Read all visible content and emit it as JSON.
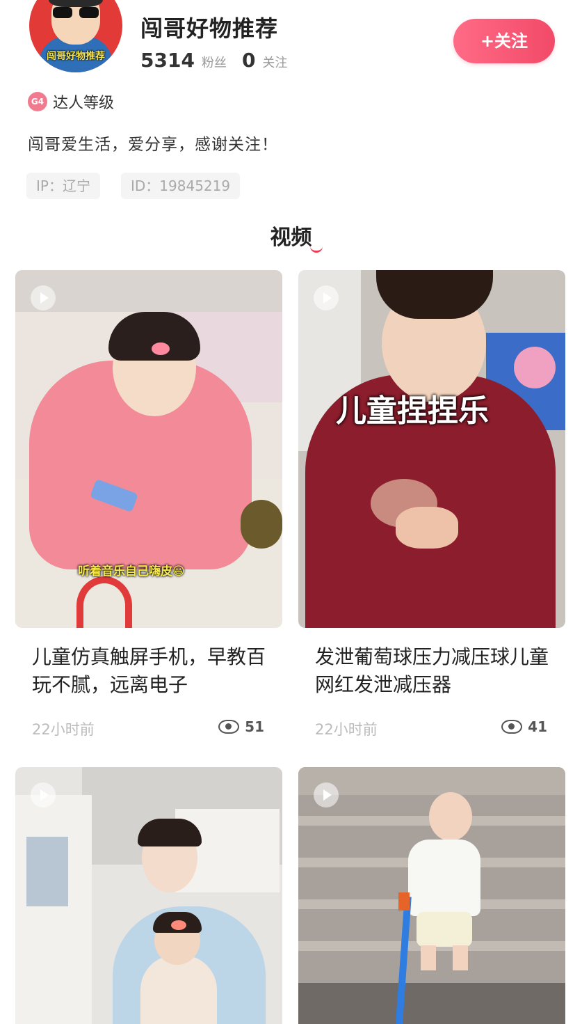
{
  "profile": {
    "avatar_caption": "闯哥好物推荐",
    "name": "闯哥好物推荐",
    "fans_count": "5314",
    "fans_label": "粉丝",
    "following_count": "0",
    "following_label": "关注",
    "follow_button": "+关注",
    "level_badge": "G4",
    "level_label": "达人等级",
    "bio": "闯哥爱生活，爱分享，感谢关注！",
    "ip_tag": "IP：辽宁",
    "id_tag": "ID：19845219"
  },
  "section_title": "视频",
  "videos": [
    {
      "overlay": "听着音乐自己嗨皮😃",
      "title": "儿童仿真触屏手机，早教百玩不腻，远离电子",
      "time": "22小时前",
      "views": "51"
    },
    {
      "overlay": "儿童捏捏乐",
      "title": "发泄葡萄球压力减压球儿童网红发泄减压器",
      "time": "22小时前",
      "views": "41"
    },
    {
      "overlay": "",
      "title": "",
      "time": "",
      "views": ""
    },
    {
      "overlay": "",
      "title": "",
      "time": "",
      "views": ""
    }
  ],
  "colors": {
    "accent": "#f24a68",
    "avatar_bg": "#e23a36",
    "tag_bg": "#f4f4f4"
  }
}
